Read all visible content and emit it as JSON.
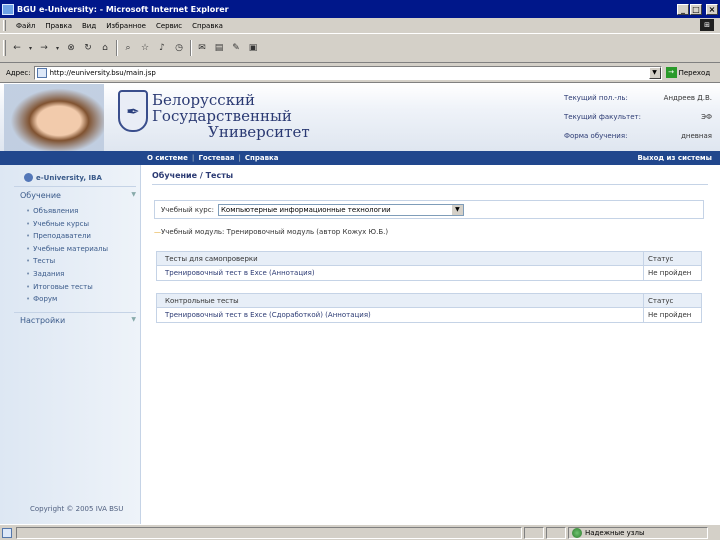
{
  "window": {
    "title": "BGU e-University: - Microsoft Internet Explorer",
    "buttons": {
      "minimize": "_",
      "maximize": "□",
      "close": "×"
    }
  },
  "menu": [
    "Файл",
    "Правка",
    "Вид",
    "Избранное",
    "Сервис",
    "Справка"
  ],
  "address": {
    "label": "Адрес:",
    "url": "http://euniversity.bsu/main.jsp",
    "go_label": "Переход"
  },
  "banner": {
    "university_lines": [
      "Белорусский",
      "Государственный",
      "Университет"
    ],
    "info": [
      {
        "label": "Текущий пол.-ль:",
        "value": "Андреев Д.В."
      },
      {
        "label": "Текущий факультет:",
        "value": "ЭФ"
      },
      {
        "label": "Форма обучения:",
        "value": "дневная"
      }
    ]
  },
  "nav": {
    "links": [
      "О системе",
      "Гостевая",
      "Справка"
    ],
    "logout": "Выход из системы"
  },
  "sidebar": {
    "brand": "e-University, IBA",
    "section_learning": "Обучение",
    "items": [
      "Объявления",
      "Учебные курсы",
      "Преподаватели",
      "Учебные материалы",
      "Тесты",
      "Задания",
      "Итоговые тесты",
      "Форум"
    ],
    "section_settings": "Настройки",
    "copyright": "Copyright © 2005 IVA BSU"
  },
  "main": {
    "breadcrumb": "Обучение / Тесты",
    "course_label": "Учебный курс:",
    "course_value": "Компьютерные информационные технологии",
    "module_text": "Учебный модуль: Тренировочный модуль (автор Кожух Ю.Б.)",
    "self_tests": {
      "header": "Тесты для самопроверки",
      "status_header": "Статус",
      "rows": [
        {
          "name": "Тренировочный тест в Exce   (Аннотация)",
          "status": "Не пройден"
        }
      ]
    },
    "control_tests": {
      "header": "Контрольные тесты",
      "status_header": "Статус",
      "rows": [
        {
          "name": "Тренировочный тест в Exce (Сдоработкой)   (Аннотация)",
          "status": "Не пройден"
        }
      ]
    }
  },
  "status": {
    "text": "",
    "zone": "Надежные узлы"
  },
  "colors": {
    "titlebar": "#00178a",
    "navbar": "#21478d",
    "chrome": "#d4d0c8",
    "link": "#2b3a73"
  }
}
